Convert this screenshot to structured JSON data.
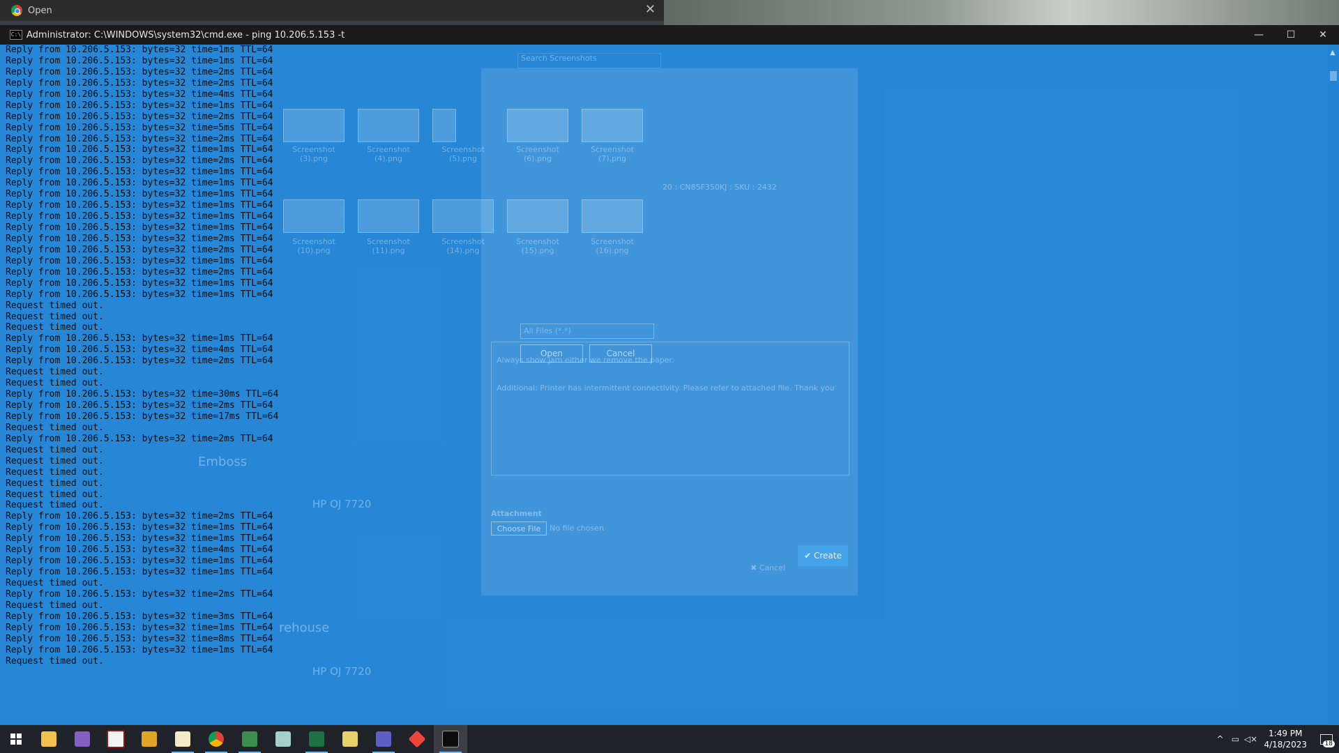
{
  "open_dialog": {
    "title": "Open"
  },
  "cmd": {
    "title": "Administrator: C:\\WINDOWS\\system32\\cmd.exe - ping  10.206.5.153 -t",
    "controls": {
      "minimize": "—",
      "maximize": "☐",
      "close": "✕"
    },
    "lines": [
      "Reply from 10.206.5.153: bytes=32 time=1ms TTL=64",
      "Reply from 10.206.5.153: bytes=32 time=1ms TTL=64",
      "Reply from 10.206.5.153: bytes=32 time=2ms TTL=64",
      "Reply from 10.206.5.153: bytes=32 time=2ms TTL=64",
      "Reply from 10.206.5.153: bytes=32 time=4ms TTL=64",
      "Reply from 10.206.5.153: bytes=32 time=1ms TTL=64",
      "Reply from 10.206.5.153: bytes=32 time=2ms TTL=64",
      "Reply from 10.206.5.153: bytes=32 time=5ms TTL=64",
      "Reply from 10.206.5.153: bytes=32 time=2ms TTL=64",
      "Reply from 10.206.5.153: bytes=32 time=1ms TTL=64",
      "Reply from 10.206.5.153: bytes=32 time=2ms TTL=64",
      "Reply from 10.206.5.153: bytes=32 time=1ms TTL=64",
      "Reply from 10.206.5.153: bytes=32 time=1ms TTL=64",
      "Reply from 10.206.5.153: bytes=32 time=1ms TTL=64",
      "Reply from 10.206.5.153: bytes=32 time=1ms TTL=64",
      "Reply from 10.206.5.153: bytes=32 time=1ms TTL=64",
      "Reply from 10.206.5.153: bytes=32 time=1ms TTL=64",
      "Reply from 10.206.5.153: bytes=32 time=2ms TTL=64",
      "Reply from 10.206.5.153: bytes=32 time=2ms TTL=64",
      "Reply from 10.206.5.153: bytes=32 time=1ms TTL=64",
      "Reply from 10.206.5.153: bytes=32 time=2ms TTL=64",
      "Reply from 10.206.5.153: bytes=32 time=1ms TTL=64",
      "Reply from 10.206.5.153: bytes=32 time=1ms TTL=64",
      "Request timed out.",
      "Request timed out.",
      "Request timed out.",
      "Reply from 10.206.5.153: bytes=32 time=1ms TTL=64",
      "Reply from 10.206.5.153: bytes=32 time=4ms TTL=64",
      "Reply from 10.206.5.153: bytes=32 time=2ms TTL=64",
      "Request timed out.",
      "Request timed out.",
      "Reply from 10.206.5.153: bytes=32 time=30ms TTL=64",
      "Reply from 10.206.5.153: bytes=32 time=2ms TTL=64",
      "Reply from 10.206.5.153: bytes=32 time=17ms TTL=64",
      "Request timed out.",
      "Reply from 10.206.5.153: bytes=32 time=2ms TTL=64",
      "Request timed out.",
      "Request timed out.",
      "Request timed out.",
      "Request timed out.",
      "Request timed out.",
      "Request timed out.",
      "Reply from 10.206.5.153: bytes=32 time=2ms TTL=64",
      "Reply from 10.206.5.153: bytes=32 time=1ms TTL=64",
      "Reply from 10.206.5.153: bytes=32 time=1ms TTL=64",
      "Reply from 10.206.5.153: bytes=32 time=4ms TTL=64",
      "Reply from 10.206.5.153: bytes=32 time=1ms TTL=64",
      "Reply from 10.206.5.153: bytes=32 time=1ms TTL=64",
      "Request timed out.",
      "Reply from 10.206.5.153: bytes=32 time=2ms TTL=64",
      "Request timed out.",
      "Reply from 10.206.5.153: bytes=32 time=3ms TTL=64",
      "Reply from 10.206.5.153: bytes=32 time=1ms TTL=64",
      "Reply from 10.206.5.153: bytes=32 time=8ms TTL=64",
      "Reply from 10.206.5.153: bytes=32 time=1ms TTL=64",
      "Request timed out."
    ]
  },
  "file_dialog_ghost": {
    "thumbnails_row1": [
      "Screenshot (3).png",
      "Screenshot (4).png",
      "Screenshot (5).png",
      "Screenshot (6).png",
      "Screenshot (7).png"
    ],
    "thumbnails_row2": [
      "Screenshot (10).png",
      "Screenshot (11).png",
      "Screenshot (14).png",
      "Screenshot (15).png",
      "Screenshot (16).png"
    ],
    "filter": "All Files (*.*)",
    "open_label": "Open",
    "cancel_label": "Cancel",
    "search_placeholder": "Search Screenshots"
  },
  "modal_ghost": {
    "text1": "Always show jam either we remove the paper.",
    "text2": "Additional: Printer has intermittent connectivity. Please refer to attached file. Thank you",
    "attachment_label": "Attachment",
    "choose_file": "Choose File",
    "no_file": "No file chosen",
    "cancel": "✖ Cancel",
    "create": "✔ Create",
    "sku_text": "20 : CN85F350KJ : SKU : 2432"
  },
  "page_ghost": {
    "emboss": "Emboss",
    "warehouse": "rehouse",
    "printer1": "HP OJ 7720",
    "printer2": "HP OJ 7720"
  },
  "taskbar": {
    "apps": [
      "start",
      "file-explorer",
      "visual-studio",
      "vs-code",
      "folder",
      "notepad",
      "chrome",
      "excel-sheets",
      "notepad-plus",
      "excel",
      "sticky",
      "teams",
      "anydesk",
      "cmd"
    ],
    "time": "1:49 PM",
    "date": "4/18/2023",
    "notification_count": "18"
  }
}
